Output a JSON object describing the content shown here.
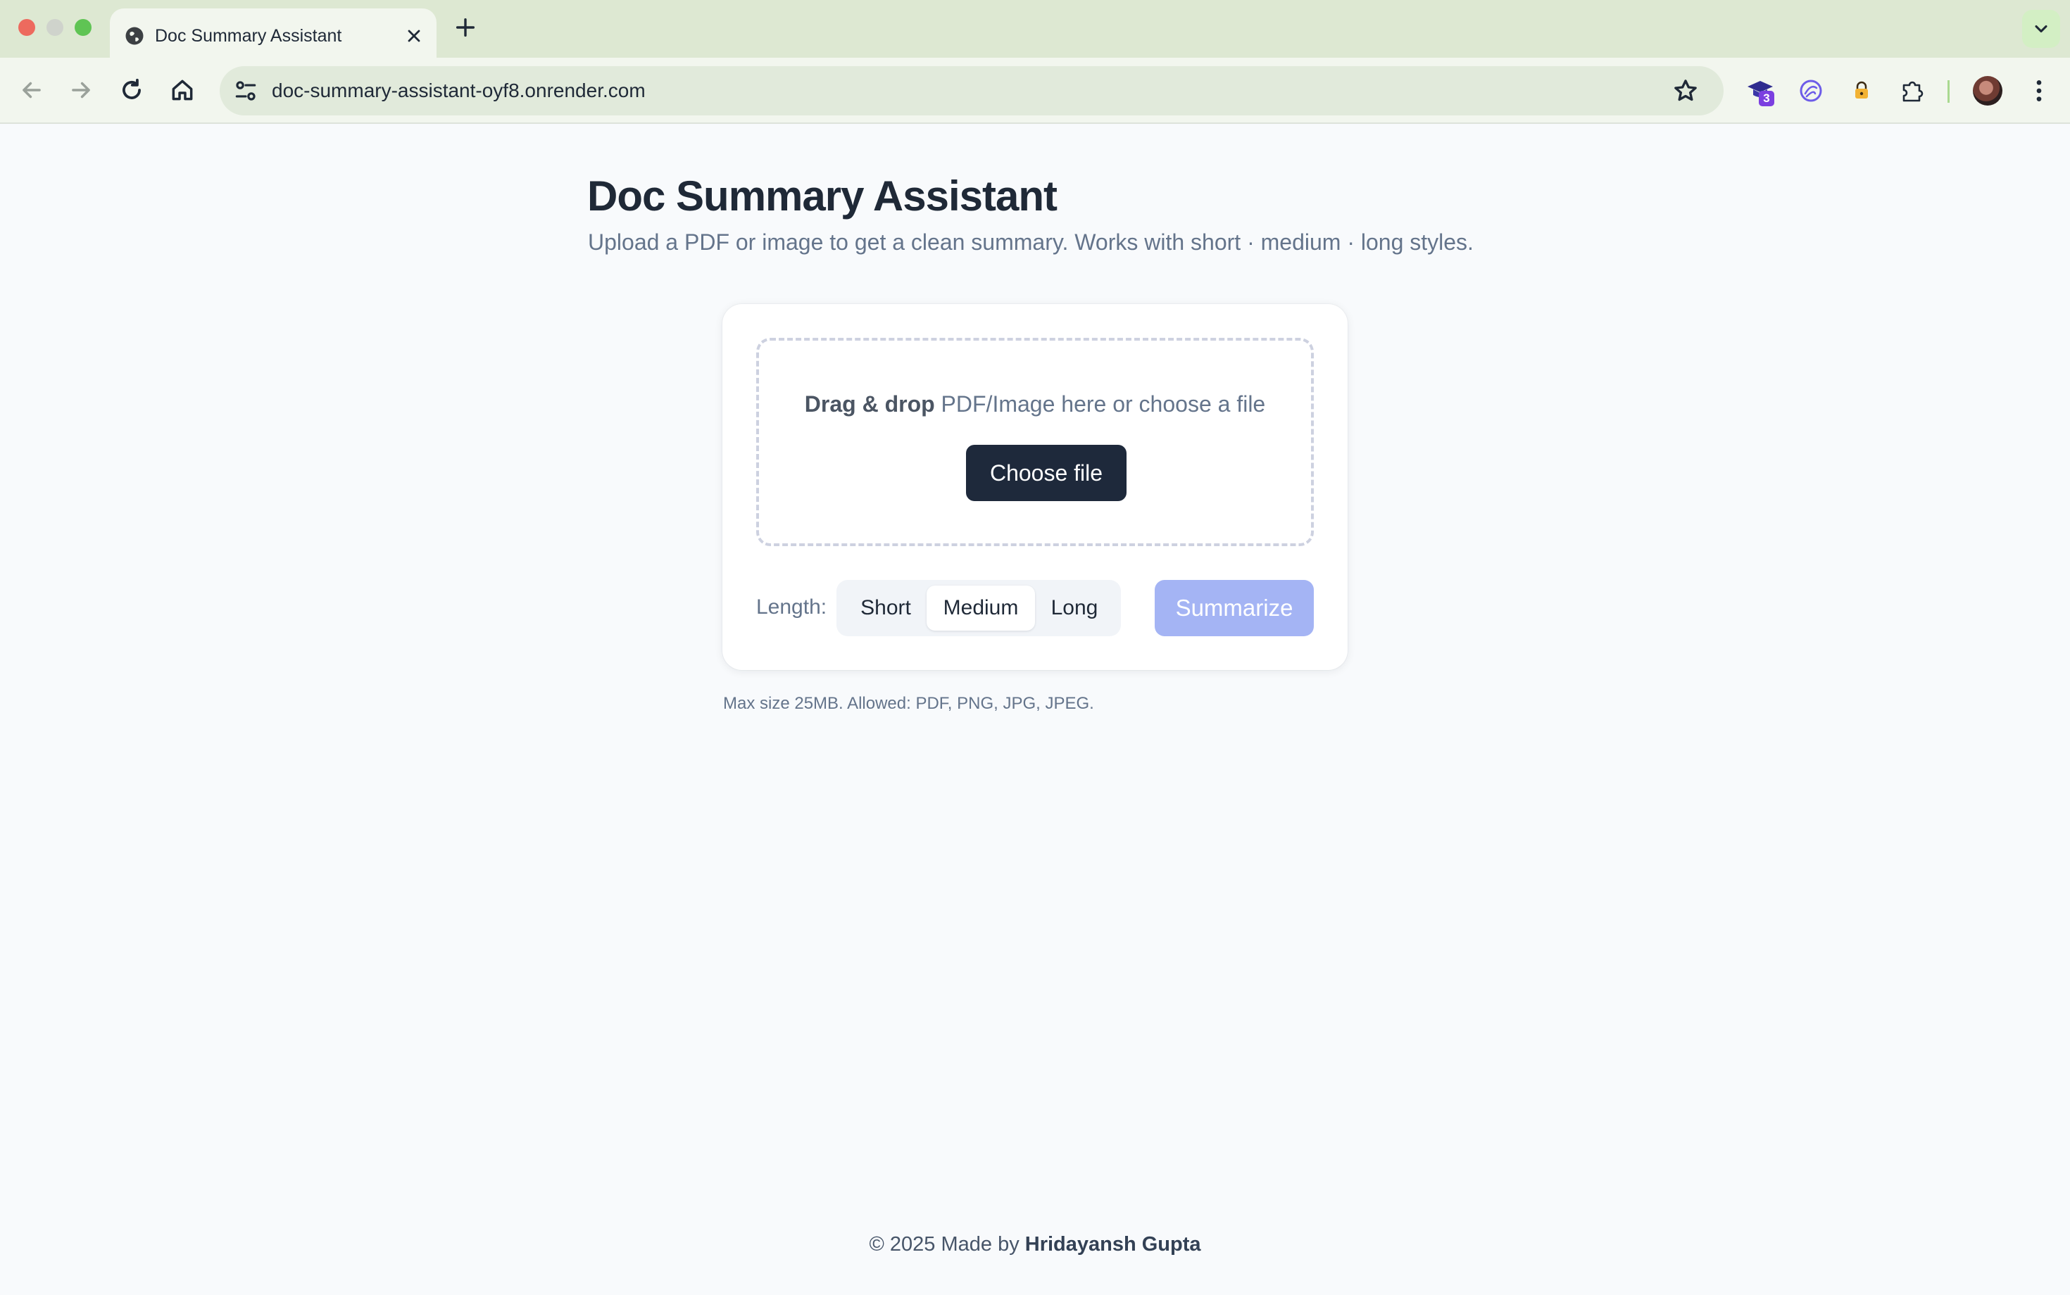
{
  "browser": {
    "tab_title": "Doc Summary Assistant",
    "url": "doc-summary-assistant-oyf8.onrender.com",
    "extension_badge": "3",
    "icons": [
      "globe-icon",
      "close-icon",
      "plus-icon",
      "chevron-down-icon",
      "back-arrow-icon",
      "forward-arrow-icon",
      "reload-icon",
      "home-icon",
      "site-settings-icon",
      "star-icon",
      "puzzle-icon",
      "kebab-menu-icon"
    ]
  },
  "page": {
    "title": "Doc Summary Assistant",
    "subtitle": "Upload a PDF or image to get a clean summary. Works with short · medium · long styles."
  },
  "upload": {
    "drop_strong": "Drag & drop",
    "drop_rest": " PDF/Image here or choose a file",
    "choose_label": "Choose file"
  },
  "length": {
    "label": "Length:",
    "options": [
      "Short",
      "Medium",
      "Long"
    ],
    "selected": "Medium"
  },
  "summarize_label": "Summarize",
  "helper_text": "Max size 25MB. Allowed: PDF, PNG, JPG, JPEG.",
  "footer": {
    "prefix": "© 2025 Made by ",
    "name": "Hridayansh Gupta"
  },
  "colors": {
    "primary_dark": "#1e293b",
    "summarize_disabled": "#a4b4f4",
    "muted_text": "#64748b",
    "page_bg": "#f8fafc"
  }
}
